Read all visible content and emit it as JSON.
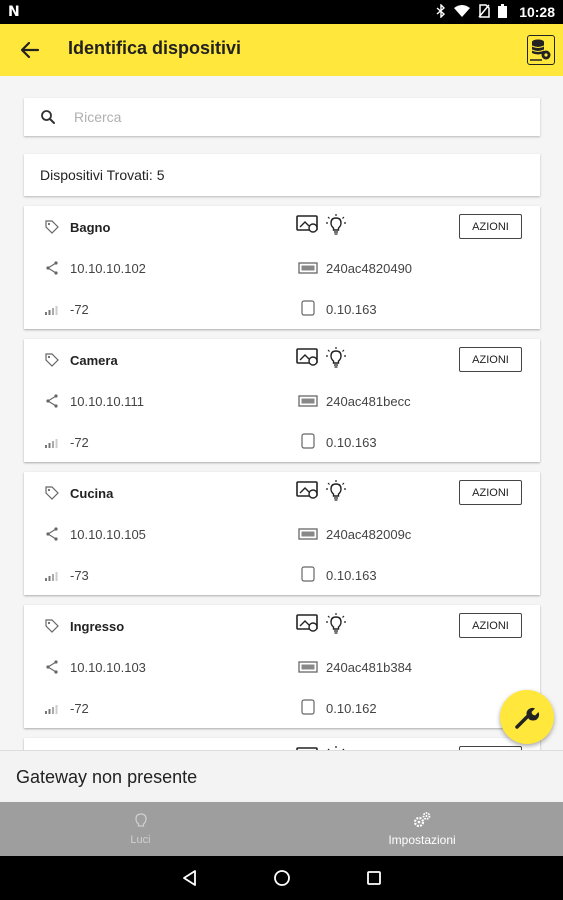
{
  "status_bar": {
    "time": "10:28",
    "left_icon": "N"
  },
  "toolbar": {
    "title": "Identifica dispositivi"
  },
  "search": {
    "placeholder": "Ricerca"
  },
  "found_label": "Dispositivi Trovati: 5",
  "actions_label": "AZIONI",
  "devices": [
    {
      "name": "Bagno",
      "ip": "10.10.10.102",
      "mac": "240ac4820490",
      "rssi": "-72",
      "fw": "0.10.163"
    },
    {
      "name": "Camera",
      "ip": "10.10.10.111",
      "mac": "240ac481becc",
      "rssi": "-72",
      "fw": "0.10.163"
    },
    {
      "name": "Cucina",
      "ip": "10.10.10.105",
      "mac": "240ac482009c",
      "rssi": "-73",
      "fw": "0.10.163"
    },
    {
      "name": "Ingresso",
      "ip": "10.10.10.103",
      "mac": "240ac481b384",
      "rssi": "-72",
      "fw": "0.10.162"
    }
  ],
  "gateway_status": "Gateway non presente",
  "bottom_nav": [
    {
      "label": "Luci",
      "icon": "bulb-icon",
      "active": false
    },
    {
      "label": "Impostazioni",
      "icon": "gears-icon",
      "active": true
    }
  ],
  "colors": {
    "accent": "#ffe83b",
    "nav_bg": "#9e9e9e"
  }
}
